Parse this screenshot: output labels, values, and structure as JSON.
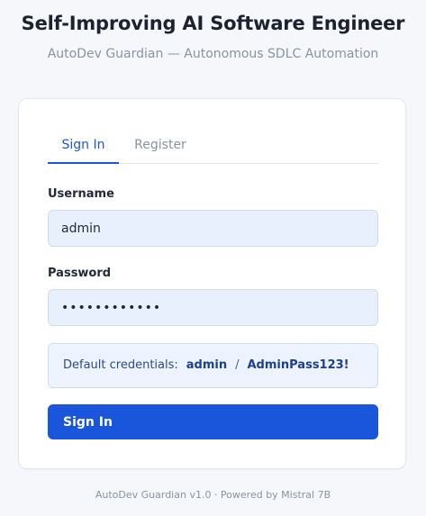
{
  "header": {
    "title": "Self-Improving AI Software Engineer",
    "subtitle": "AutoDev Guardian — Autonomous SDLC Automation"
  },
  "tabs": [
    {
      "label": "Sign In",
      "active": true
    },
    {
      "label": "Register",
      "active": false
    }
  ],
  "form": {
    "username_label": "Username",
    "username_value": "admin",
    "password_label": "Password",
    "password_value": "adminpass123",
    "submit_label": "Sign In"
  },
  "credentials": {
    "lead": "Default credentials:",
    "username": "admin",
    "separator": "/",
    "password": "AdminPass123!"
  },
  "footer": {
    "text": "AutoDev Guardian v1.0 · Powered by Mistral 7B"
  },
  "colors": {
    "accent": "#1a56db",
    "background": "#f5f7fa"
  }
}
